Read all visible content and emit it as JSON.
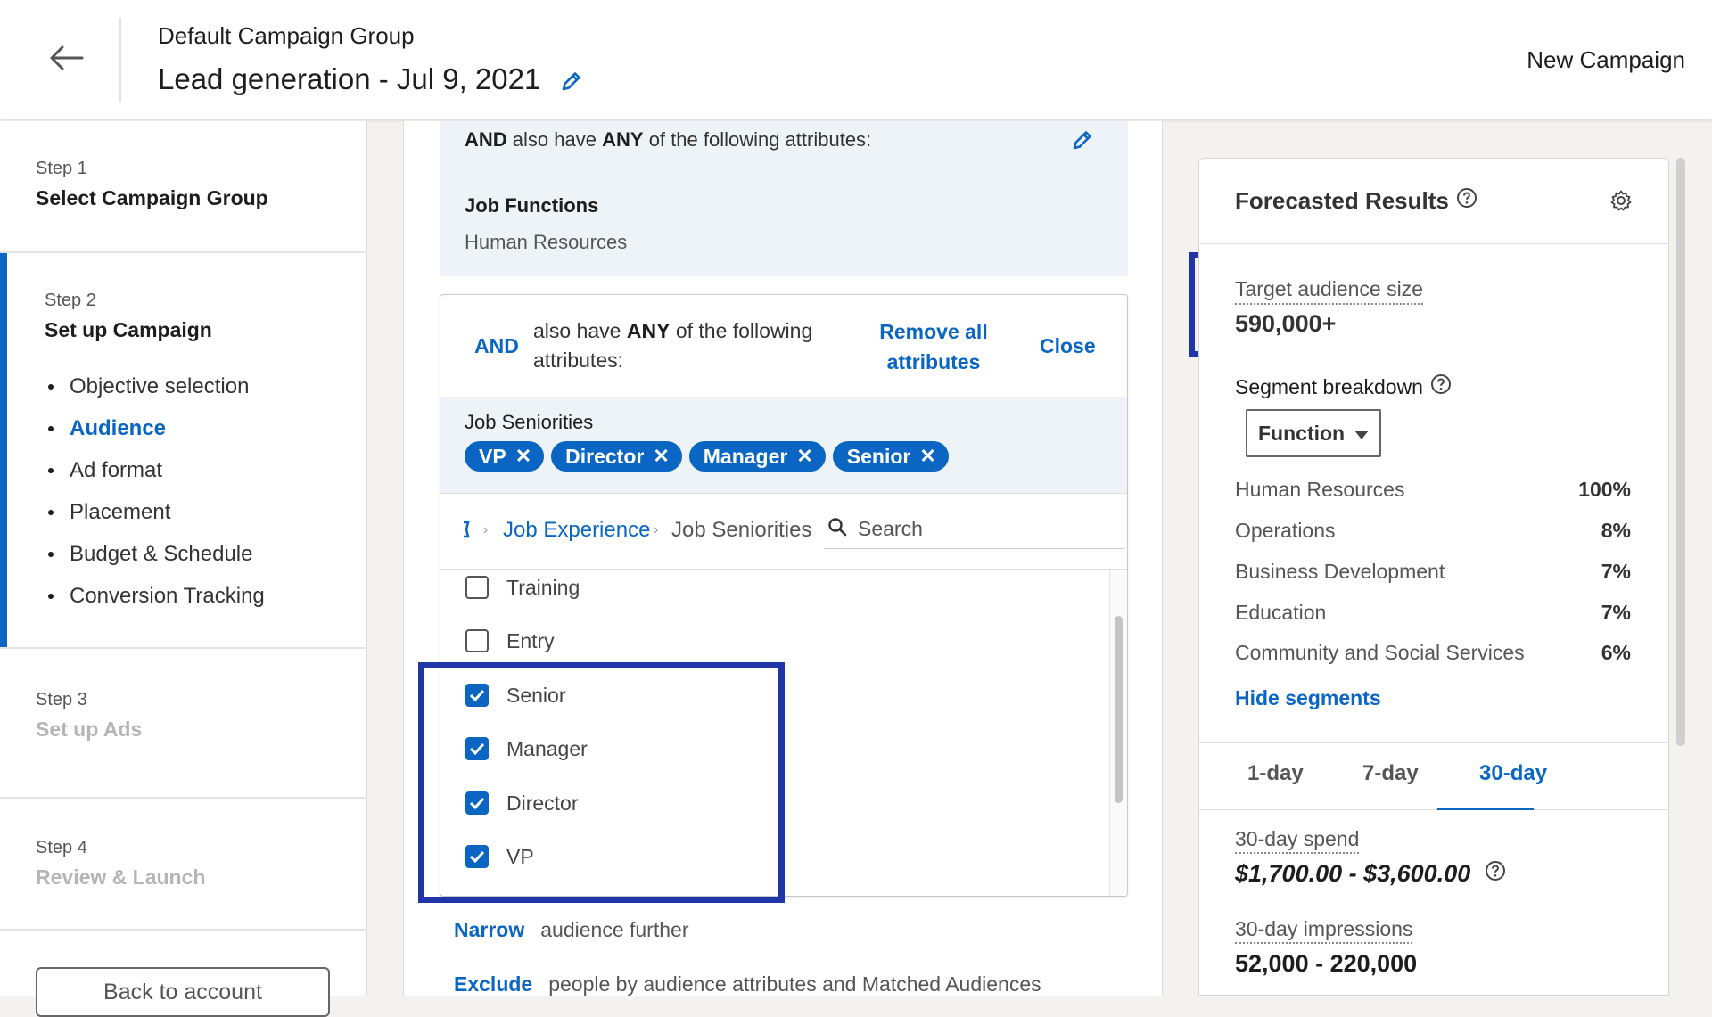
{
  "header": {
    "group_name": "Default Campaign Group",
    "campaign_name": "Lead generation - Jul 9, 2021",
    "new_campaign": "New Campaign"
  },
  "sidebar": {
    "step1": {
      "num": "Step 1",
      "title": "Select Campaign Group"
    },
    "step2": {
      "num": "Step 2",
      "title": "Set up Campaign",
      "items": [
        {
          "label": "Objective selection",
          "active": false
        },
        {
          "label": "Audience",
          "active": true
        },
        {
          "label": "Ad format",
          "active": false
        },
        {
          "label": "Placement",
          "active": false
        },
        {
          "label": "Budget & Schedule",
          "active": false
        },
        {
          "label": "Conversion Tracking",
          "active": false
        }
      ]
    },
    "step3": {
      "num": "Step 3",
      "title": "Set up Ads"
    },
    "step4": {
      "num": "Step 4",
      "title": "Review & Launch"
    },
    "back_button": "Back to account"
  },
  "audience": {
    "summary": {
      "and": "AND",
      "also_have": "also have",
      "any": "ANY",
      "rest": "of the following attributes:",
      "category_title": "Job Functions",
      "category_value": "Human Resources"
    },
    "editor": {
      "and": "AND",
      "text_pre": "also have",
      "text_any": "ANY",
      "text_post": "of the following attributes:",
      "remove_all": "Remove all attributes",
      "close": "Close",
      "selected_title": "Job Seniorities",
      "pills": [
        "VP",
        "Director",
        "Manager",
        "Senior"
      ],
      "breadcrumb_home": "❰",
      "breadcrumb_parent": "Job Experience",
      "breadcrumb_current": "Job Seniorities",
      "search_placeholder": "Search",
      "options": [
        {
          "label": "Training",
          "checked": false
        },
        {
          "label": "Entry",
          "checked": false
        },
        {
          "label": "Senior",
          "checked": true
        },
        {
          "label": "Manager",
          "checked": true
        },
        {
          "label": "Director",
          "checked": true
        },
        {
          "label": "VP",
          "checked": true
        }
      ]
    },
    "narrow": {
      "link": "Narrow",
      "text": "audience further"
    },
    "exclude": {
      "link": "Exclude",
      "text": "people by audience attributes and Matched Audiences"
    }
  },
  "forecast": {
    "title": "Forecasted Results",
    "target_label": "Target audience size",
    "target_value": "590,000+",
    "segment_label": "Segment breakdown",
    "segment_select": "Function",
    "segments": [
      {
        "name": "Human Resources",
        "pct": "100%"
      },
      {
        "name": "Operations",
        "pct": "8%"
      },
      {
        "name": "Business Development",
        "pct": "7%"
      },
      {
        "name": "Education",
        "pct": "7%"
      },
      {
        "name": "Community and Social Services",
        "pct": "6%"
      }
    ],
    "hide_segments": "Hide segments",
    "tabs": [
      "1-day",
      "7-day",
      "30-day"
    ],
    "active_tab": "30-day",
    "spend_label": "30-day spend",
    "spend_value": "$1,700.00 - $3,600.00",
    "impressions_label": "30-day impressions",
    "impressions_value": "52,000 - 220,000"
  },
  "colors": {
    "accent": "#0a66c2",
    "highlight_box": "#1f35a8"
  }
}
